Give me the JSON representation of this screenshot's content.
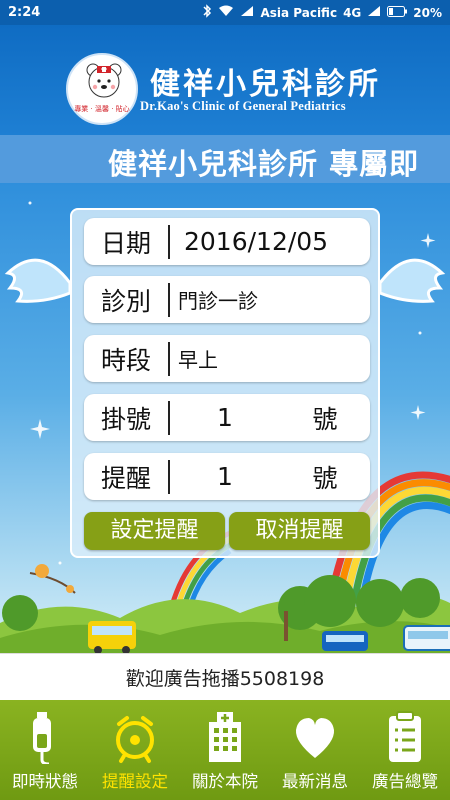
{
  "status_bar": {
    "time": "2:24",
    "carrier": "Asia Pacific",
    "network": "4G",
    "battery": "20%"
  },
  "header": {
    "title_cn": "健祥小兒科診所",
    "title_en": "Dr.Kao's Clinic of General Pediatrics",
    "logo_tagline": "專業 · 溫馨 · 貼心"
  },
  "marquee": {
    "text": "健祥小兒科診所 專屬即"
  },
  "form": {
    "date": {
      "label": "日期",
      "value": "2016/12/05"
    },
    "clinic": {
      "label": "診別",
      "value": "門診一診"
    },
    "period": {
      "label": "時段",
      "value": "早上"
    },
    "number": {
      "label": "掛號",
      "value": "1",
      "unit": "號"
    },
    "reminder": {
      "label": "提醒",
      "value": "1",
      "unit": "號"
    },
    "set_button": "設定提醒",
    "cancel_button": "取消提醒"
  },
  "ad_bar": {
    "text": "歡迎廣告拖播5508198"
  },
  "nav": {
    "active_index": 1,
    "items": [
      {
        "label": "即時狀態",
        "icon": "iv-drip-icon"
      },
      {
        "label": "提醒設定",
        "icon": "alarm-clock-icon"
      },
      {
        "label": "關於本院",
        "icon": "hospital-icon"
      },
      {
        "label": "最新消息",
        "icon": "heart-icon"
      },
      {
        "label": "廣告總覽",
        "icon": "clipboard-icon"
      }
    ]
  },
  "colors": {
    "header_blue": "#0f6cc3",
    "nav_green": "#7aa61a",
    "button_green": "#86a016",
    "active_nav": "#ffe300"
  }
}
